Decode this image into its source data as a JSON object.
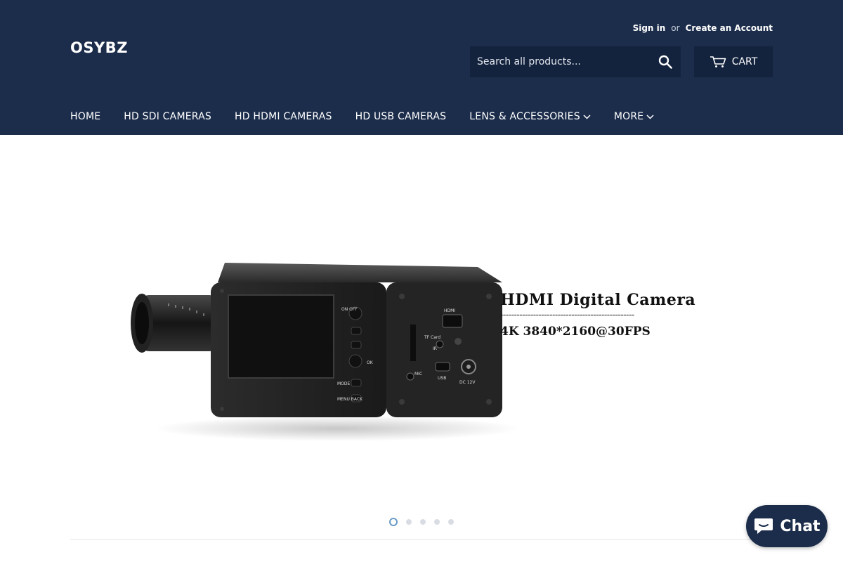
{
  "header": {
    "logo": "OSYBZ",
    "account": {
      "sign_in": "Sign in",
      "or": "or",
      "create_account": "Create an Account"
    },
    "search": {
      "placeholder": "Search all products..."
    },
    "cart": {
      "label": "CART",
      "icon": "cart-icon"
    },
    "nav": [
      {
        "label": "HOME"
      },
      {
        "label": "HD SDI CAMERAS"
      },
      {
        "label": "HD HDMI CAMERAS"
      },
      {
        "label": "HD USB CAMERAS"
      },
      {
        "label": "LENS & ACCESSORIES",
        "has_dropdown": true
      },
      {
        "label": "MORE",
        "has_dropdown": true
      }
    ]
  },
  "hero": {
    "caption_title": "HDMI Digital Camera",
    "caption_dashes": "-------------------------------------------------",
    "caption_sub": "4K 3840*2160@30FPS",
    "camera_labels": {
      "on_off": "ON OFF",
      "hdmi": "HDMI",
      "tf_card": "TF Card",
      "ir": "IR",
      "ok": "OK",
      "mode": "MODE",
      "menu_back": "MENU BACK",
      "mic": "MIC",
      "usb": "USB",
      "dc": "DC 12V"
    },
    "slides": {
      "count": 5,
      "active_index": 0
    }
  },
  "chat": {
    "label": "Chat"
  },
  "colors": {
    "header_bg": "#1c2d4b",
    "control_bg": "#13223d",
    "active_dot": "#6b9bc6"
  }
}
